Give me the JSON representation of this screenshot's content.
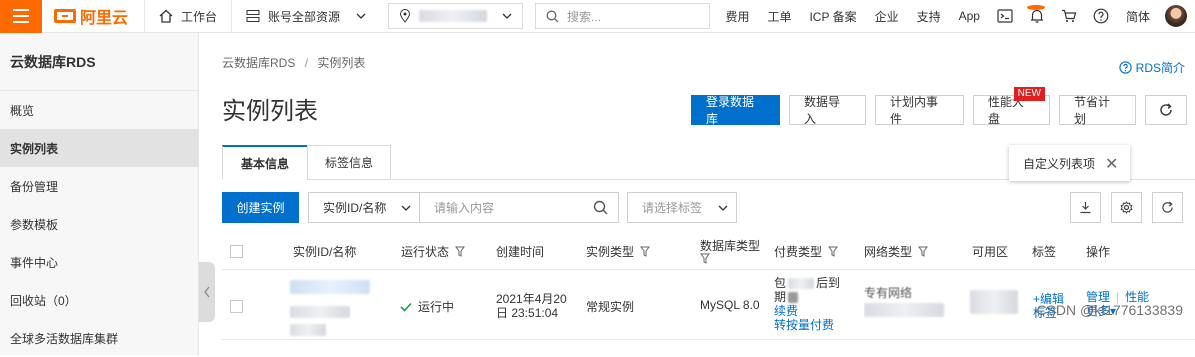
{
  "topbar": {
    "logo_text": "阿里云",
    "workbench": "工作台",
    "account_resources": "账号全部资源",
    "search_placeholder": "搜索...",
    "nav": [
      "费用",
      "工单",
      "ICP 备案",
      "企业",
      "支持",
      "App"
    ],
    "lang": "简体",
    "accent_color": "#ff6a00"
  },
  "sidebar": {
    "title": "云数据库RDS",
    "items": [
      {
        "label": "概览"
      },
      {
        "label": "实例列表"
      },
      {
        "label": "备份管理"
      },
      {
        "label": "参数模板"
      },
      {
        "label": "事件中心"
      },
      {
        "label": "回收站（0）"
      },
      {
        "label": "全球多活数据库集群"
      }
    ]
  },
  "main": {
    "breadcrumb": [
      "云数据库RDS",
      "实例列表"
    ],
    "breadcrumb_sep": "/",
    "rds_intro": "RDS简介",
    "title": "实例列表",
    "buttons": {
      "login_db": "登录数据库",
      "import": "数据导入",
      "events": "计划内事件",
      "perf": "性能大盘",
      "new_badge": "NEW",
      "savings": "节省计划"
    },
    "tabs": [
      "基本信息",
      "标签信息"
    ],
    "popover": "自定义列表项",
    "toolbar": {
      "create": "创建实例",
      "filter_field": "实例ID/名称",
      "input_placeholder": "请输入内容",
      "tag_placeholder": "请选择标签"
    },
    "columns": [
      "实例ID/名称",
      "运行状态",
      "创建时间",
      "实例类型",
      "数据库类型",
      "付费类型",
      "网络类型",
      "可用区",
      "标签",
      "操作"
    ],
    "row": {
      "status": "运行中",
      "created_date": "2021年4月20",
      "created_time": "日 23:51:04",
      "instance_type": "常规实例",
      "db_type": "MySQL 8.0",
      "pay_line1": "包",
      "pay_line1b": "后到",
      "pay_line2": "期",
      "renew": "续费",
      "switch_pay": "转按量付费",
      "network": "专有网络",
      "tag_edit": "+编辑",
      "tag_label": "标签",
      "action_manage": "管理",
      "action_perf": "性能",
      "action_more": "更多▾"
    }
  },
  "watermark": "CSDN @kt1776133839",
  "primary_color": "#0070cc"
}
